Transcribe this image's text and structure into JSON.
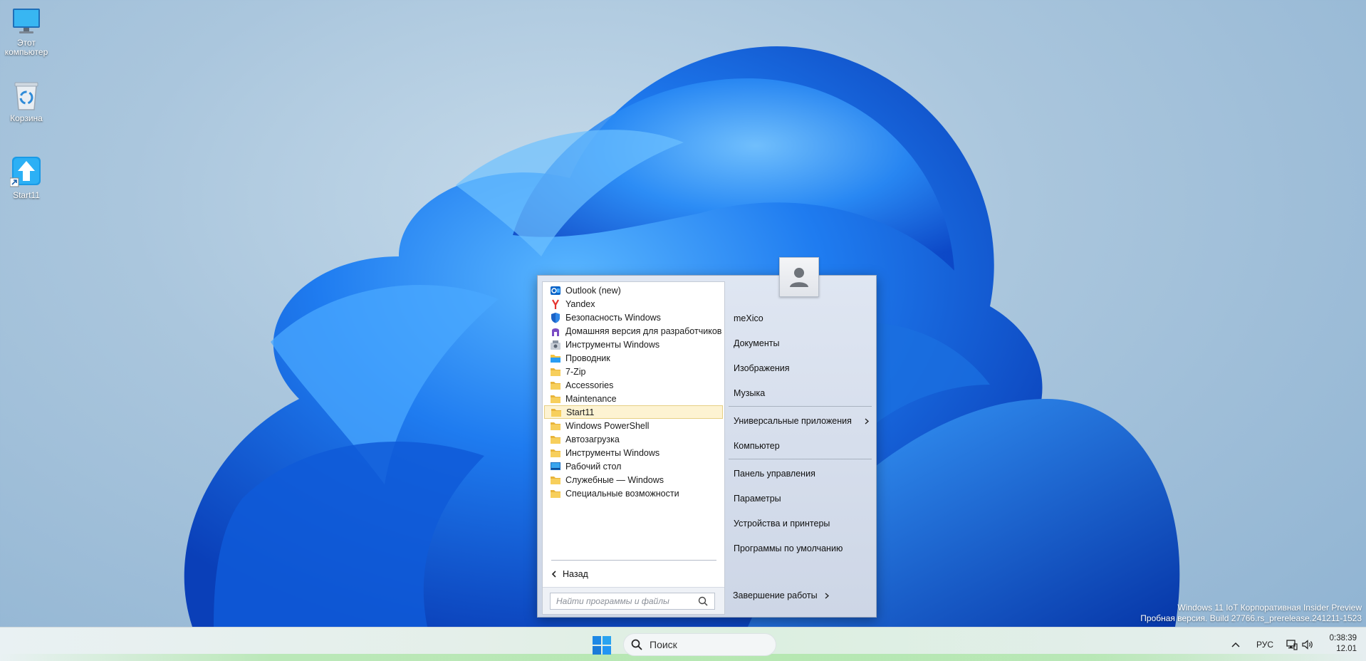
{
  "desktop": {
    "icons": [
      {
        "label_line1": "Этот",
        "label_line2": "компьютер",
        "icon": "monitor-icon"
      },
      {
        "label_line1": "Корзина",
        "icon": "recycle-bin-icon"
      },
      {
        "label_line1": "Start11",
        "icon": "start11-shortcut-icon"
      }
    ]
  },
  "start_menu": {
    "programs": [
      {
        "label": "Outlook (new)",
        "icon": "outlook-icon"
      },
      {
        "label": "Yandex",
        "icon": "yandex-icon"
      },
      {
        "label": "Безопасность Windows",
        "icon": "shield-icon"
      },
      {
        "label": "Домашняя версия для разработчиков",
        "icon": "dev-home-icon"
      },
      {
        "label": "Инструменты Windows",
        "icon": "windows-tools-icon"
      },
      {
        "label": "Проводник",
        "icon": "explorer-icon"
      },
      {
        "label": "7-Zip",
        "icon": "folder-icon"
      },
      {
        "label": "Accessories",
        "icon": "folder-icon"
      },
      {
        "label": "Maintenance",
        "icon": "folder-icon"
      },
      {
        "label": "Start11",
        "icon": "folder-icon",
        "selected": true
      },
      {
        "label": "Windows PowerShell",
        "icon": "folder-icon"
      },
      {
        "label": "Автозагрузка",
        "icon": "folder-icon"
      },
      {
        "label": "Инструменты Windows",
        "icon": "folder-icon"
      },
      {
        "label": "Рабочий стол",
        "icon": "desktop-icon"
      },
      {
        "label": "Служебные — Windows",
        "icon": "folder-icon"
      },
      {
        "label": "Специальные возможности",
        "icon": "folder-icon"
      }
    ],
    "back_label": "Назад",
    "search_placeholder": "Найти программы и файлы",
    "right": {
      "user": "meXico",
      "documents": "Документы",
      "pictures": "Изображения",
      "music": "Музыка",
      "universal_apps": "Универсальные приложения",
      "computer": "Компьютер",
      "control_panel": "Панель управления",
      "settings": "Параметры",
      "devices": "Устройства и принтеры",
      "default_programs": "Программы по умолчанию",
      "shutdown": "Завершение работы"
    }
  },
  "watermark": {
    "line1": "Windows 11 IoT Корпоративная Insider Preview",
    "line2": "Пробная версия. Build 27766.rs_prerelease.241211-1523"
  },
  "taskbar": {
    "search_label": "Поиск",
    "language": "РУС",
    "time": "0:38:39",
    "date": "12.01"
  },
  "colors": {
    "windows_blue": "#1e88e5",
    "selected_bg": "#fdf3d2",
    "folder_yellow": "#f5c542"
  }
}
